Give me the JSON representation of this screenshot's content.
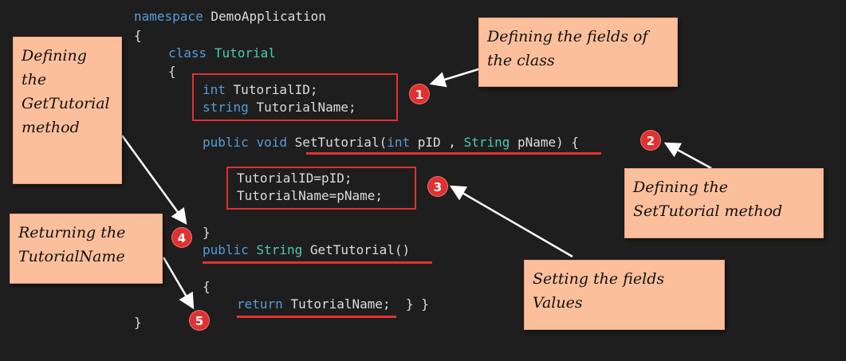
{
  "code": {
    "line_namespace_kw": "namespace",
    "line_namespace_name": "DemoApplication",
    "brace_open_ns": "{",
    "class_kw": "class",
    "class_name": "Tutorial",
    "brace_open_class": "{",
    "field1_type": "int",
    "field1_name": "TutorialID;",
    "field2_type": "string",
    "field2_name": "TutorialName;",
    "set_public": "public",
    "set_void": "void",
    "set_name": "SetTutorial(",
    "set_int": "int",
    "set_pid": "pID ,",
    "set_string": "String",
    "set_pname": "pName) {",
    "assign1": "TutorialID=pID;",
    "assign2": "TutorialName=pName;",
    "brace_close_set": "}",
    "get_public": "public",
    "get_string": "String",
    "get_name": "GetTutorial()",
    "brace_open_get": "{",
    "return_kw": "return",
    "return_val": "TutorialName;  } }",
    "brace_close_ns": "}"
  },
  "notes": {
    "fields": "Defining the fields of the class",
    "get_method": "Defining the GetTutorial method",
    "set_method": "Defining the SetTutorial method",
    "returning": "Returning the TutorialName",
    "setting": "Setting the fields Values"
  },
  "badges": [
    "1",
    "2",
    "3",
    "4",
    "5"
  ],
  "colors": {
    "background": "#1e1e1e",
    "keyword": "#569cd6",
    "type": "#4ec9b0",
    "text": "#dcdcdc",
    "note_fill": "#fcbf9c",
    "highlight_red": "#e03131",
    "arrow": "#ffffff"
  }
}
